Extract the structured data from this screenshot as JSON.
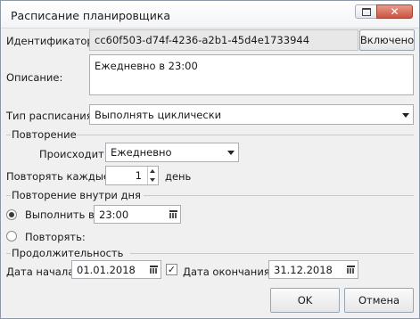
{
  "window": {
    "title": "Расписание планировщика",
    "close_glyph": "✕"
  },
  "identifier": {
    "label": "Идентификатор:",
    "value": "cc60f503-d74f-4236-a2b1-45d4e1733944",
    "toggle_label": "Включено"
  },
  "description": {
    "label": "Описание:",
    "value": "Ежедневно в 23:00"
  },
  "schedule_type": {
    "label": "Тип расписания:",
    "value": "Выполнять циклически"
  },
  "repeat": {
    "group_title": "Повторение",
    "occurs_label": "Происходит:",
    "occurs_value": "Ежедневно",
    "every_label": "Повторять каждые:",
    "every_value": "1",
    "unit_label": "день"
  },
  "intraday": {
    "group_title": "Повторение внутри дня",
    "run_at_label": "Выполнить в:",
    "run_at_value": "23:00",
    "run_at_selected": true,
    "repeat_label": "Повторять:",
    "repeat_selected": false
  },
  "duration": {
    "group_title": "Продолжительность",
    "start_label": "Дата начала:",
    "start_value": "01.01.2018",
    "end_checked": true,
    "end_check_glyph": "✓",
    "end_label": "Дата окончания:",
    "end_value": "31.12.2018"
  },
  "buttons": {
    "ok": "OK",
    "cancel": "Отмена"
  },
  "icons": {
    "calendar": "calendar-icon",
    "dropdown": "chevron-down-icon",
    "spinner": "spinner-arrows-icon"
  }
}
